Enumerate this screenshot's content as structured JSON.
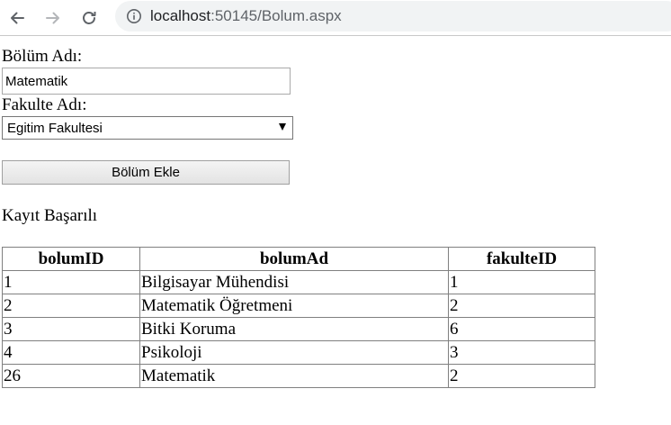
{
  "browser": {
    "url_host": "localhost",
    "url_rest": ":50145/Bolum.aspx"
  },
  "form": {
    "bolum_label": "Bölüm Adı:",
    "bolum_value": "Matematik",
    "fakulte_label": "Fakulte Adı:",
    "fakulte_selected": "Egitim Fakultesi",
    "submit_label": "Bölüm Ekle",
    "status": "Kayıt Başarılı"
  },
  "table": {
    "headers": [
      "bolumID",
      "bolumAd",
      "fakulteID"
    ],
    "rows": [
      [
        "1",
        "Bilgisayar Mühendisi",
        "1"
      ],
      [
        "2",
        "Matematik Öğretmeni",
        "2"
      ],
      [
        "3",
        "Bitki Koruma",
        "6"
      ],
      [
        "4",
        "Psikoloji",
        "3"
      ],
      [
        "26",
        "Matematik",
        "2"
      ]
    ]
  }
}
